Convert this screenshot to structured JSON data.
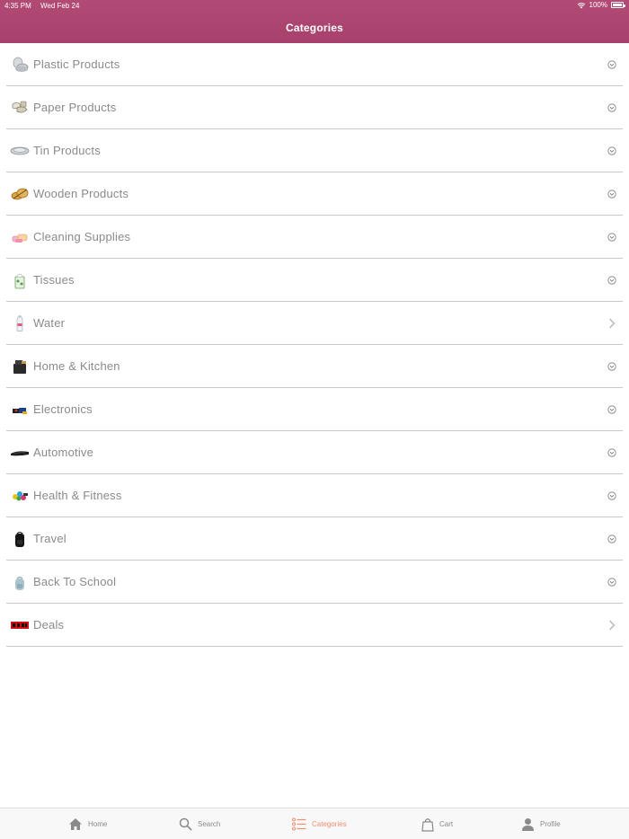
{
  "status": {
    "time": "4:35 PM",
    "date": "Wed Feb 24",
    "battery": "100%"
  },
  "header": {
    "title": "Categories"
  },
  "categories": [
    {
      "label": "Plastic Products",
      "icon": "plastic-products-icon",
      "indicator": "expand"
    },
    {
      "label": "Paper Products",
      "icon": "paper-products-icon",
      "indicator": "expand"
    },
    {
      "label": "Tin Products",
      "icon": "tin-products-icon",
      "indicator": "expand"
    },
    {
      "label": "Wooden Products",
      "icon": "wooden-products-icon",
      "indicator": "expand"
    },
    {
      "label": "Cleaning Supplies",
      "icon": "cleaning-supplies-icon",
      "indicator": "expand"
    },
    {
      "label": "Tissues",
      "icon": "tissues-icon",
      "indicator": "expand"
    },
    {
      "label": "Water",
      "icon": "water-bottle-icon",
      "indicator": "navigate"
    },
    {
      "label": "Home & Kitchen",
      "icon": "home-kitchen-icon",
      "indicator": "expand"
    },
    {
      "label": "Electronics",
      "icon": "electronics-icon",
      "indicator": "expand"
    },
    {
      "label": "Automotive",
      "icon": "automotive-icon",
      "indicator": "expand"
    },
    {
      "label": "Health & Fitness",
      "icon": "health-fitness-icon",
      "indicator": "expand"
    },
    {
      "label": "Travel",
      "icon": "travel-backpack-icon",
      "indicator": "expand"
    },
    {
      "label": "Back To School",
      "icon": "school-backpack-icon",
      "indicator": "expand"
    },
    {
      "label": "Deals",
      "icon": "deals-icon",
      "indicator": "navigate"
    }
  ],
  "tabbar": {
    "home": "Home",
    "search": "Search",
    "categories": "Categories",
    "cart": "Cart",
    "profile": "Profile",
    "active": "categories",
    "active_color": "#ef8f74"
  },
  "colors": {
    "header": "#ab436f",
    "label": "#8a8a8a",
    "divider": "#c8c8c8"
  }
}
